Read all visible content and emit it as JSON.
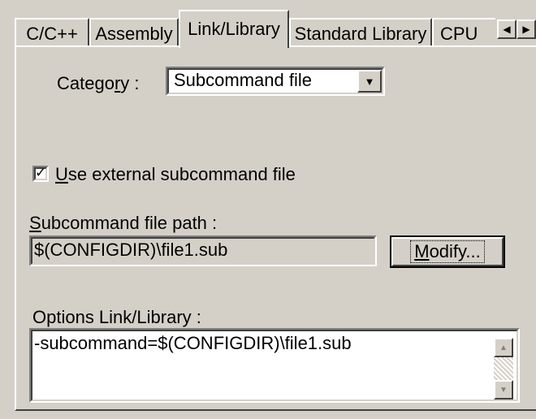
{
  "tabs": [
    {
      "label": "C/C++",
      "active": false
    },
    {
      "label": "Assembly",
      "active": false
    },
    {
      "label": "Link/Library",
      "active": true
    },
    {
      "label": "Standard Library",
      "active": false
    },
    {
      "label": "CPU",
      "active": false
    }
  ],
  "tab_scroll": {
    "left_icon": "arrow-left-icon",
    "right_icon": "arrow-right-icon"
  },
  "category": {
    "label_pre": "Catego",
    "label_mnemonic": "r",
    "label_post": "y :",
    "selected": "Subcommand file"
  },
  "use_external": {
    "checked": true,
    "label_mnemonic": "U",
    "label_rest": "se external subcommand file"
  },
  "subcommand_path": {
    "label_mnemonic": "S",
    "label_rest": "ubcommand file path :",
    "value": "$(CONFIGDIR)\\file1.sub",
    "modify_mnemonic": "M",
    "modify_rest": "odify..."
  },
  "options": {
    "label": "Options Link/Library :",
    "value": "-subcommand=$(CONFIGDIR)\\file1.sub"
  },
  "colors": {
    "face": "#d4d0c8",
    "highlight": "#ffffff",
    "shadow": "#808080",
    "dark_shadow": "#404040",
    "field_disabled": "#d4d0c8",
    "field_enabled": "#ffffff"
  }
}
